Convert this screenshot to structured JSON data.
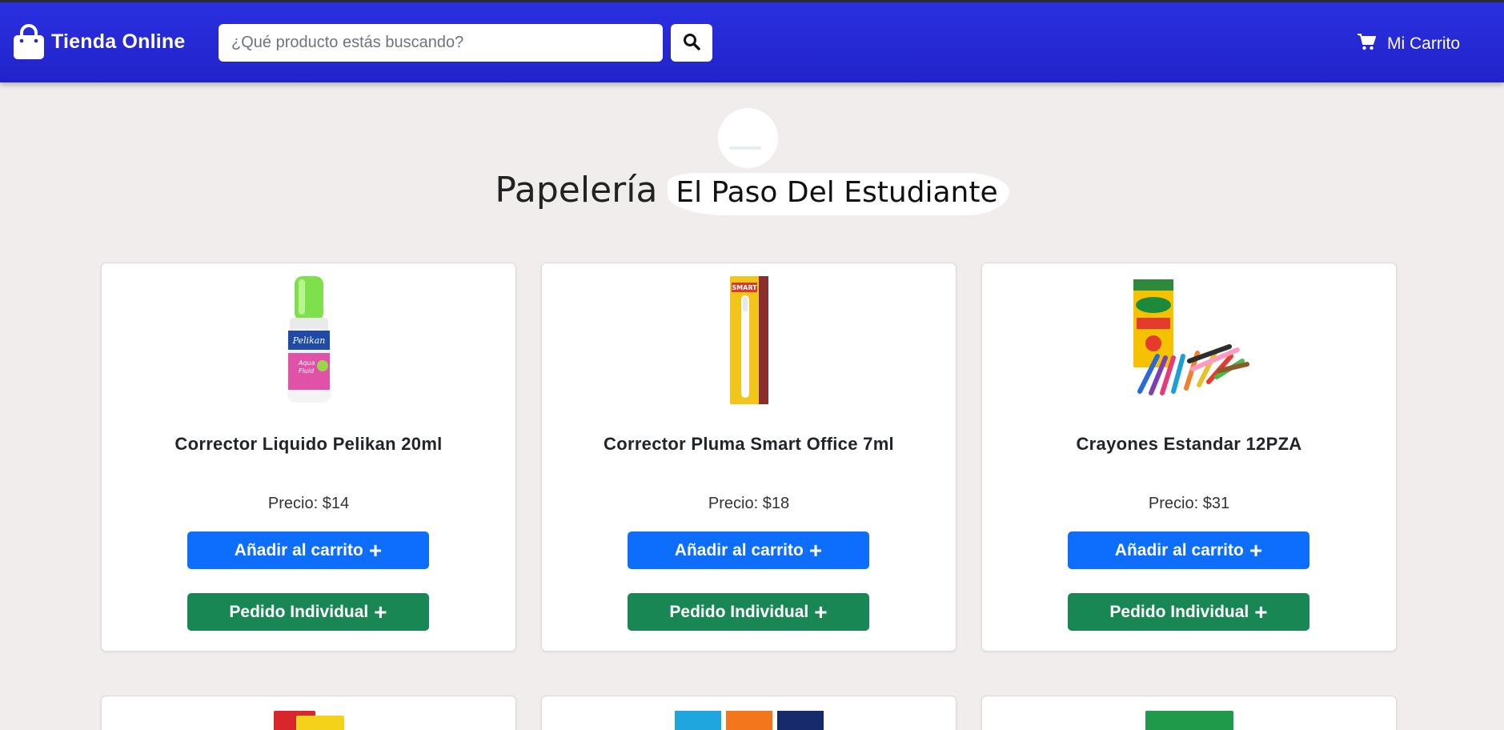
{
  "navbar": {
    "brand": "Tienda Online",
    "brand_icon": "shopping-bag-icon",
    "search_placeholder": "¿Qué producto estás buscando?",
    "search_icon": "search-icon",
    "cart_label": "Mi Carrito",
    "cart_icon": "cart-icon",
    "colors": {
      "bar": "#2427d6"
    }
  },
  "store": {
    "title_part1": "Papelería",
    "title_part2": "El Paso Del Estudiante"
  },
  "products": [
    {
      "name": "Corrector Liquido Pelikan 20ml",
      "price": "Precio: $14",
      "add_label": "Añadir al carrito",
      "order_label": "Pedido Individual"
    },
    {
      "name": "Corrector Pluma Smart Office 7ml",
      "price": "Precio: $18",
      "add_label": "Añadir al carrito",
      "order_label": "Pedido Individual"
    },
    {
      "name": "Crayones Estandar 12PZA",
      "price": "Precio: $31",
      "add_label": "Añadir al carrito",
      "order_label": "Pedido Individual"
    }
  ],
  "colors": {
    "add_button": "#0d6efd",
    "order_button": "#198754",
    "background": "#f0edec"
  }
}
